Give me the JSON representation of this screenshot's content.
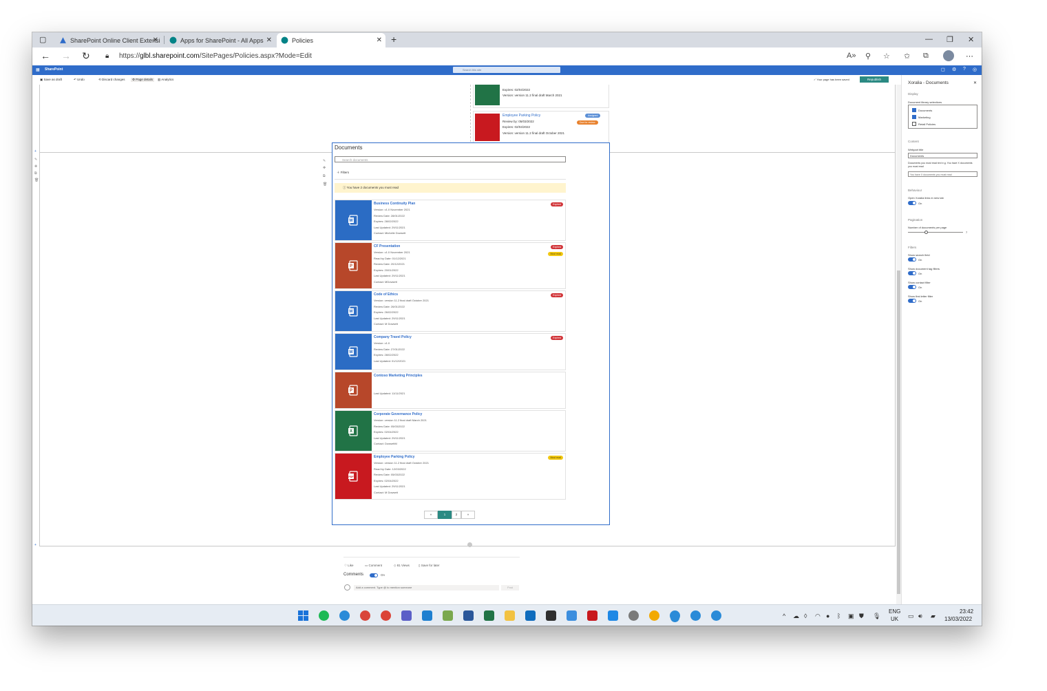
{
  "browser": {
    "tabs": [
      {
        "label": "SharePoint Online Client Extensi",
        "active": false
      },
      {
        "label": "Apps for SharePoint - All Apps",
        "active": false
      },
      {
        "label": "Policies",
        "active": true
      }
    ],
    "url_prefix": "https://",
    "url_host": "glbl.sharepoint.com",
    "url_path": "/SitePages/Policies.aspx?Mode=Edit"
  },
  "suitebar": {
    "brand": "SharePoint",
    "search_placeholder": "Search this site"
  },
  "commandbar": {
    "save_as_draft": "Save as draft",
    "undo": "Undo",
    "discard_changes": "Discard changes",
    "page_details": "Page details",
    "analytics": "Analytics",
    "saved_status": "Your page has been saved",
    "republish": "Republish"
  },
  "top_cards": [
    {
      "expires": "Expires: 02/04/2022",
      "version": "Version: version 11.2 final draft March 2021"
    },
    {
      "title": "Employee Parking Policy",
      "review_by": "Review by: 05/03/2022",
      "expires": "Expires: 02/04/2022",
      "version": "Version: version 11.2 final draft October 2021",
      "badge1": "Assigned",
      "badge2": "Due for review"
    }
  ],
  "webpart": {
    "title": "Documents",
    "search_placeholder": "Search documents",
    "filters_label": "Filters",
    "notice": "You have 2 documents you must read",
    "documents": [
      {
        "title": "Business Continuity Plan",
        "type": "word",
        "color": "#2b6cc4",
        "lines": [
          "Version: v1.0 November 2021",
          "Review Date: 28/01/2022",
          "Expires: 28/02/2022",
          "Last Updated: 29/11/2021",
          "Contact: Michelle Dowsett"
        ],
        "badges": [
          {
            "text": "Expired",
            "kind": "red"
          }
        ]
      },
      {
        "title": "CF Presentation",
        "type": "powerpoint",
        "color": "#b7472a",
        "lines": [
          "Version: v1.0 November 2021",
          "Read by Date: 01/12/2021",
          "Review Date: 20/12/2021",
          "Expires: 20/01/2022",
          "Last Updated: 29/11/2021",
          "Contact: MDowsett"
        ],
        "badges": [
          {
            "text": "Expired",
            "kind": "red"
          },
          {
            "text": "Must read",
            "kind": "yellow"
          }
        ]
      },
      {
        "title": "Code of Ethics",
        "type": "word",
        "color": "#2b6cc4",
        "lines": [
          "Version: version 11.2 final draft October 2021",
          "Review Date: 26/01/2022",
          "Expires: 26/02/2022",
          "Last Updated: 29/11/2021",
          "Contact: M Dowsett"
        ],
        "badges": [
          {
            "text": "Expired",
            "kind": "red"
          }
        ]
      },
      {
        "title": "Company Travel Policy",
        "type": "word",
        "color": "#2b6cc4",
        "lines": [
          "Version: v1.0",
          "Review Date: 27/01/2022",
          "Expires: 28/02/2022",
          "Last Updated: 01/12/2021"
        ],
        "badges": [
          {
            "text": "Expired",
            "kind": "red"
          }
        ]
      },
      {
        "title": "Contoso Marketing Principles",
        "type": "powerpoint",
        "color": "#b7472a",
        "lines": [
          "",
          "",
          "Last Updated: 11/11/2021"
        ],
        "badges": []
      },
      {
        "title": "Corporate Governance Policy",
        "type": "excel",
        "color": "#217346",
        "lines": [
          "Version: version 11.2 final draft March 2021",
          "Review Date: 05/03/2022",
          "Expires: 02/04/2022",
          "Last Updated: 29/11/2021",
          "Contact: DowsettM"
        ],
        "badges": []
      },
      {
        "title": "Employee Parking Policy",
        "type": "pdf",
        "color": "#c8191f",
        "lines": [
          "Version: version 11.2 final draft October 2021",
          "Read by Date: 12/03/2022",
          "Review Date: 05/03/2022",
          "Expires: 02/04/2022",
          "Last Updated: 29/11/2021",
          "Contact: M Dowsett"
        ],
        "badges": [
          {
            "text": "Must read",
            "kind": "yellow"
          }
        ]
      }
    ],
    "pager": {
      "prev": "«",
      "page1": "1",
      "page2": "2",
      "next": "»"
    }
  },
  "footer": {
    "like": "Like",
    "comment": "Comment",
    "views": "81 Views",
    "save_for_later": "Save for later",
    "comments_label": "Comments",
    "comments_state": "On",
    "comment_placeholder": "Add a comment. Type @ to mention someone",
    "post": "Post"
  },
  "pane": {
    "title": "Xoralia - Documents",
    "display": "Display",
    "library_label": "Document library selections",
    "libraries": [
      {
        "label": "Documents",
        "checked": true
      },
      {
        "label": "Marketing",
        "checked": true
      },
      {
        "label": "Retail Policies",
        "checked": false
      }
    ],
    "content": "Content",
    "webpart_title_label": "Webpart title",
    "webpart_title_value": "Documents",
    "must_read_label": "Documents you must read text e.g. You have X documents you must read",
    "must_read_value": "You have X documents you must read",
    "behaviour": "Behaviour",
    "open_links_label": "Open Xoralia links in new tab",
    "on": "On",
    "pagination": "Pagination",
    "per_page_label": "Number of documents per page",
    "per_page_value": "7",
    "filters": "Filters",
    "show_search": "Show search field",
    "show_tag_filters": "Show document tag filters",
    "show_contact_filter": "Show contact filter",
    "show_first_letter": "Show first letter filter"
  },
  "taskbar": {
    "lang": "ENG",
    "region": "UK",
    "time": "23:42",
    "date": "13/03/2022"
  }
}
